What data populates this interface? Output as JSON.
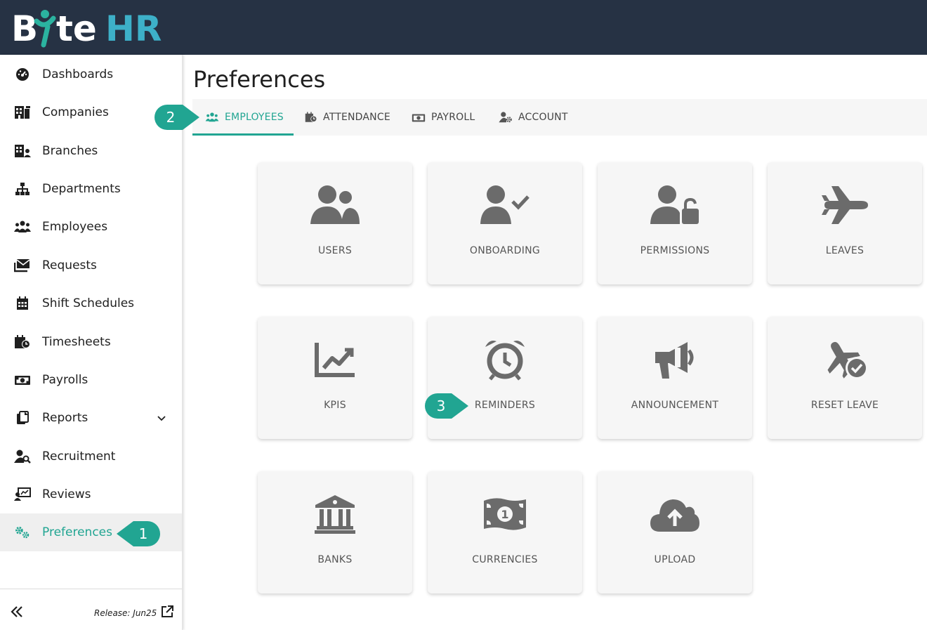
{
  "app": {
    "logo_text": "ByteHR"
  },
  "sidebar": {
    "items": [
      {
        "label": "Dashboards",
        "icon": "dashboard-gauge-icon"
      },
      {
        "label": "Companies",
        "icon": "building-icon"
      },
      {
        "label": "Branches",
        "icon": "building-user-icon"
      },
      {
        "label": "Departments",
        "icon": "sitemap-icon"
      },
      {
        "label": "Employees",
        "icon": "users-icon"
      },
      {
        "label": "Requests",
        "icon": "envelope-inbox-icon"
      },
      {
        "label": "Shift Schedules",
        "icon": "calendar-grid-icon"
      },
      {
        "label": "Timesheets",
        "icon": "calendar-clock-icon"
      },
      {
        "label": "Payrolls",
        "icon": "money-bill-icon"
      },
      {
        "label": "Reports",
        "icon": "file-copy-icon"
      },
      {
        "label": "Recruitment",
        "icon": "user-search-icon"
      },
      {
        "label": "Reviews",
        "icon": "chalkboard-user-icon"
      },
      {
        "label": "Preferences",
        "icon": "gears-icon"
      }
    ],
    "active": "Preferences",
    "footer": {
      "release": "Release: Jun25"
    }
  },
  "main": {
    "title": "Preferences",
    "tabs": [
      {
        "label": "EMPLOYEES",
        "icon": "users-icon"
      },
      {
        "label": "ATTENDANCE",
        "icon": "calendar-clock-icon"
      },
      {
        "label": "PAYROLL",
        "icon": "money-bill-icon"
      },
      {
        "label": "ACCOUNT",
        "icon": "user-gear-icon"
      }
    ],
    "active_tab": "EMPLOYEES",
    "tiles": [
      {
        "label": "USERS",
        "icon": "users-icon"
      },
      {
        "label": "ONBOARDING",
        "icon": "user-check-icon"
      },
      {
        "label": "PERMISSIONS",
        "icon": "user-lock-icon"
      },
      {
        "label": "LEAVES",
        "icon": "plane-icon"
      },
      {
        "label": "KPIS",
        "icon": "chart-line-icon"
      },
      {
        "label": "REMINDERS",
        "icon": "alarm-clock-icon"
      },
      {
        "label": "ANNOUNCEMENT",
        "icon": "megaphone-icon"
      },
      {
        "label": "RESET LEAVE",
        "icon": "plane-check-icon"
      },
      {
        "label": "BANKS",
        "icon": "bank-icon"
      },
      {
        "label": "CURRENCIES",
        "icon": "money-bill-1-icon"
      },
      {
        "label": "UPLOAD",
        "icon": "cloud-upload-icon"
      }
    ]
  },
  "callouts": [
    "1",
    "2",
    "3"
  ],
  "colors": {
    "accent": "#21a592",
    "header_bg": "#263244",
    "tile_bg": "#f6f6f6",
    "icon_gray": "#6b6b6b"
  }
}
